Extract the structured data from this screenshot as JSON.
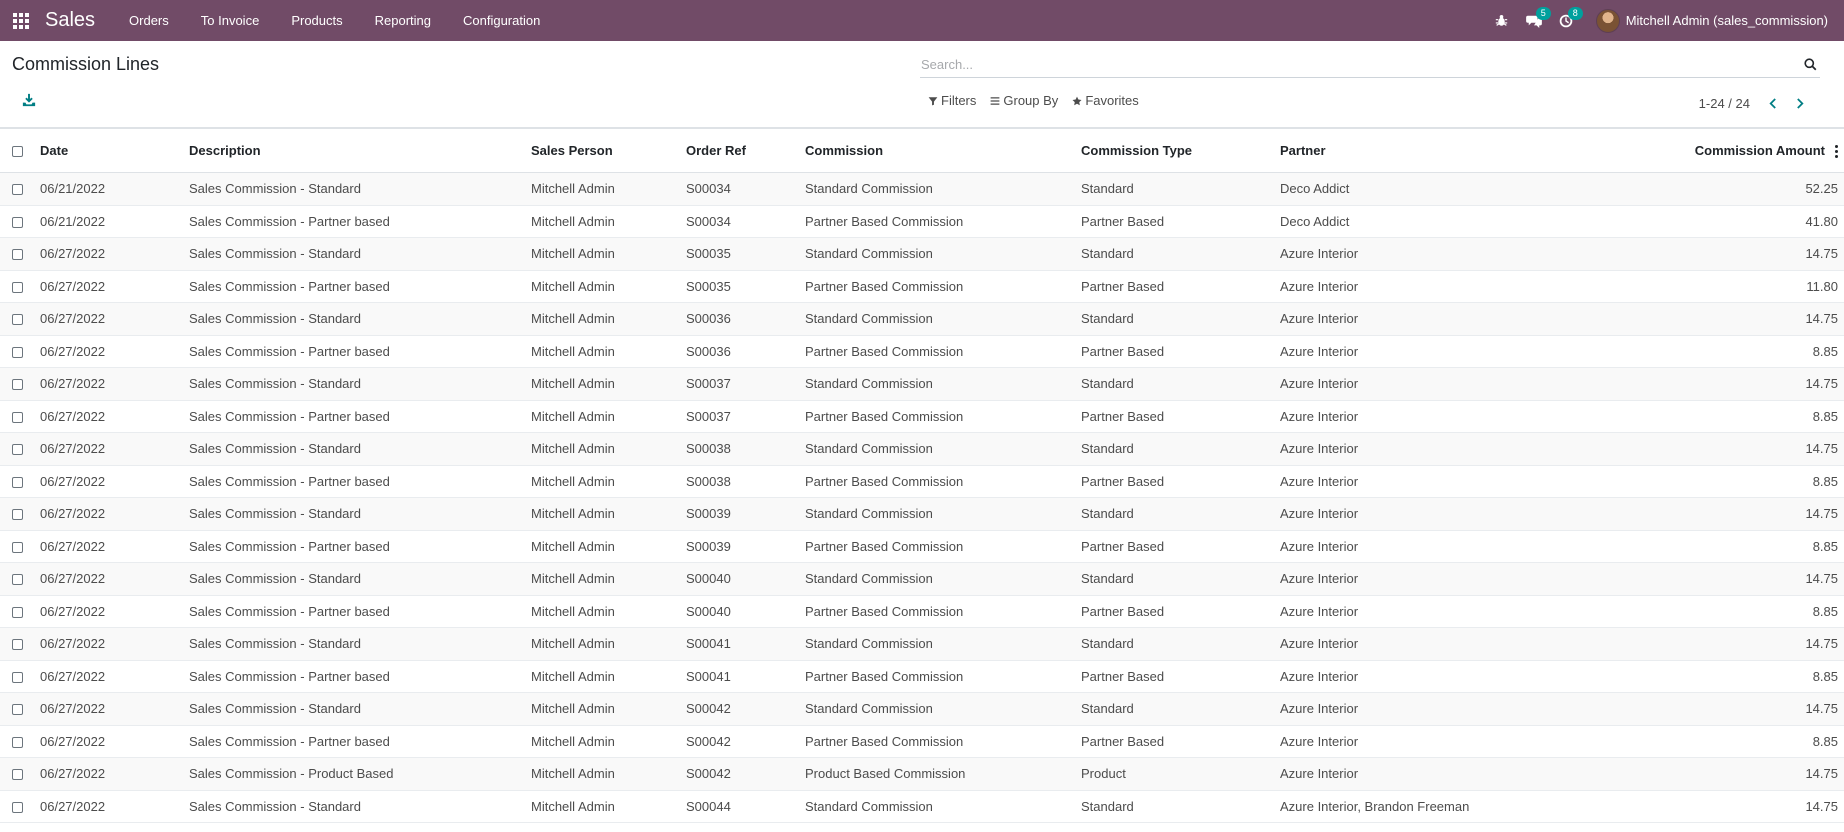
{
  "navbar": {
    "brand": "Sales",
    "menu": [
      "Orders",
      "To Invoice",
      "Products",
      "Reporting",
      "Configuration"
    ],
    "messages_badge": "5",
    "activities_badge": "8",
    "user": "Mitchell Admin (sales_commission)",
    "color": "#714b67"
  },
  "control": {
    "title": "Commission Lines",
    "search_placeholder": "Search...",
    "filters_label": "Filters",
    "groupby_label": "Group By",
    "favorites_label": "Favorites",
    "pager": "1-24 / 24"
  },
  "table": {
    "headers": [
      "Date",
      "Description",
      "Sales Person",
      "Order Ref",
      "Commission",
      "Commission Type",
      "Partner",
      "Commission Amount"
    ],
    "rows": [
      [
        "06/21/2022",
        "Sales Commission - Standard",
        "Mitchell Admin",
        "S00034",
        "Standard Commission",
        "Standard",
        "Deco Addict",
        "52.25"
      ],
      [
        "06/21/2022",
        "Sales Commission - Partner based",
        "Mitchell Admin",
        "S00034",
        "Partner Based Commission",
        "Partner Based",
        "Deco Addict",
        "41.80"
      ],
      [
        "06/27/2022",
        "Sales Commission - Standard",
        "Mitchell Admin",
        "S00035",
        "Standard Commission",
        "Standard",
        "Azure Interior",
        "14.75"
      ],
      [
        "06/27/2022",
        "Sales Commission - Partner based",
        "Mitchell Admin",
        "S00035",
        "Partner Based Commission",
        "Partner Based",
        "Azure Interior",
        "11.80"
      ],
      [
        "06/27/2022",
        "Sales Commission - Standard",
        "Mitchell Admin",
        "S00036",
        "Standard Commission",
        "Standard",
        "Azure Interior",
        "14.75"
      ],
      [
        "06/27/2022",
        "Sales Commission - Partner based",
        "Mitchell Admin",
        "S00036",
        "Partner Based Commission",
        "Partner Based",
        "Azure Interior",
        "8.85"
      ],
      [
        "06/27/2022",
        "Sales Commission - Standard",
        "Mitchell Admin",
        "S00037",
        "Standard Commission",
        "Standard",
        "Azure Interior",
        "14.75"
      ],
      [
        "06/27/2022",
        "Sales Commission - Partner based",
        "Mitchell Admin",
        "S00037",
        "Partner Based Commission",
        "Partner Based",
        "Azure Interior",
        "8.85"
      ],
      [
        "06/27/2022",
        "Sales Commission - Standard",
        "Mitchell Admin",
        "S00038",
        "Standard Commission",
        "Standard",
        "Azure Interior",
        "14.75"
      ],
      [
        "06/27/2022",
        "Sales Commission - Partner based",
        "Mitchell Admin",
        "S00038",
        "Partner Based Commission",
        "Partner Based",
        "Azure Interior",
        "8.85"
      ],
      [
        "06/27/2022",
        "Sales Commission - Standard",
        "Mitchell Admin",
        "S00039",
        "Standard Commission",
        "Standard",
        "Azure Interior",
        "14.75"
      ],
      [
        "06/27/2022",
        "Sales Commission - Partner based",
        "Mitchell Admin",
        "S00039",
        "Partner Based Commission",
        "Partner Based",
        "Azure Interior",
        "8.85"
      ],
      [
        "06/27/2022",
        "Sales Commission - Standard",
        "Mitchell Admin",
        "S00040",
        "Standard Commission",
        "Standard",
        "Azure Interior",
        "14.75"
      ],
      [
        "06/27/2022",
        "Sales Commission - Partner based",
        "Mitchell Admin",
        "S00040",
        "Partner Based Commission",
        "Partner Based",
        "Azure Interior",
        "8.85"
      ],
      [
        "06/27/2022",
        "Sales Commission - Standard",
        "Mitchell Admin",
        "S00041",
        "Standard Commission",
        "Standard",
        "Azure Interior",
        "14.75"
      ],
      [
        "06/27/2022",
        "Sales Commission - Partner based",
        "Mitchell Admin",
        "S00041",
        "Partner Based Commission",
        "Partner Based",
        "Azure Interior",
        "8.85"
      ],
      [
        "06/27/2022",
        "Sales Commission - Standard",
        "Mitchell Admin",
        "S00042",
        "Standard Commission",
        "Standard",
        "Azure Interior",
        "14.75"
      ],
      [
        "06/27/2022",
        "Sales Commission - Partner based",
        "Mitchell Admin",
        "S00042",
        "Partner Based Commission",
        "Partner Based",
        "Azure Interior",
        "8.85"
      ],
      [
        "06/27/2022",
        "Sales Commission - Product Based",
        "Mitchell Admin",
        "S00042",
        "Product Based Commission",
        "Product",
        "Azure Interior",
        "14.75"
      ],
      [
        "06/27/2022",
        "Sales Commission - Standard",
        "Mitchell Admin",
        "S00044",
        "Standard Commission",
        "Standard",
        "Azure Interior, Brandon Freeman",
        "14.75"
      ]
    ]
  }
}
